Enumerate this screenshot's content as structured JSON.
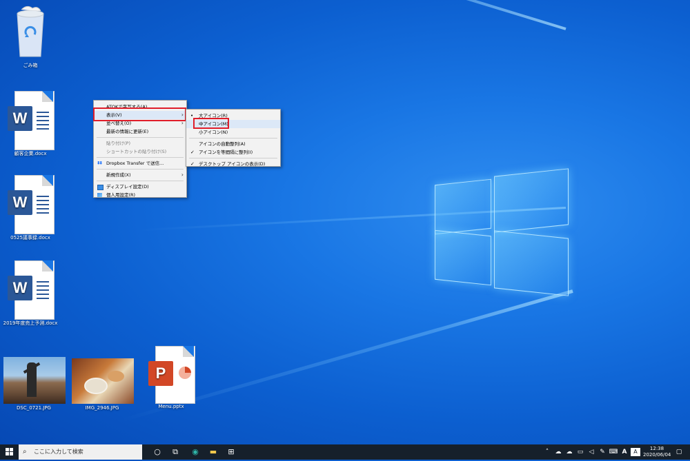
{
  "desktop": {
    "icons": [
      {
        "caption": "ごみ箱"
      },
      {
        "caption": "顧客企業.docx"
      },
      {
        "caption": "0525議事録.docx"
      },
      {
        "caption": "2019年度売上予測.docx"
      },
      {
        "caption": "DSC_0721.JPG"
      },
      {
        "caption": "IMG_2946.JPG"
      },
      {
        "caption": "Menu.pptx"
      }
    ]
  },
  "context_menu": {
    "items": [
      {
        "label": "ATOKで字写する(A)"
      },
      {
        "label": "表示(V)"
      },
      {
        "label": "並べ替え(O)"
      },
      {
        "label": "最新の情報に更新(E)"
      },
      {
        "label": "貼り付け(P)"
      },
      {
        "label": "ショートカットの貼り付け(S)"
      },
      {
        "label": "Dropbox Transfer で送信..."
      },
      {
        "label": "新規作成(X)"
      },
      {
        "label": "ディスプレイ設定(D)"
      },
      {
        "label": "個人用設定(R)"
      }
    ],
    "highlighted": "表示(V)"
  },
  "view_submenu": {
    "items": [
      {
        "label": "大アイコン(R)",
        "mark": "•"
      },
      {
        "label": "中アイコン(M)",
        "mark": ""
      },
      {
        "label": "小アイコン(N)",
        "mark": ""
      },
      {
        "label": "アイコンの自動整列(A)",
        "mark": ""
      },
      {
        "label": "アイコンを等間隔に整列(I)",
        "mark": "✓"
      },
      {
        "label": "デスクトップ アイコンの表示(D)",
        "mark": "✓"
      }
    ],
    "highlighted": "中アイコン(M)"
  },
  "taskbar": {
    "search_placeholder": "ここに入力して検索",
    "time": "12:38",
    "date": "2020/06/04"
  },
  "colors": {
    "highlight_box": "#e01d2a",
    "taskbar_bg": "#16202b",
    "word_blue": "#2b5797",
    "ppt_orange": "#d24726"
  }
}
